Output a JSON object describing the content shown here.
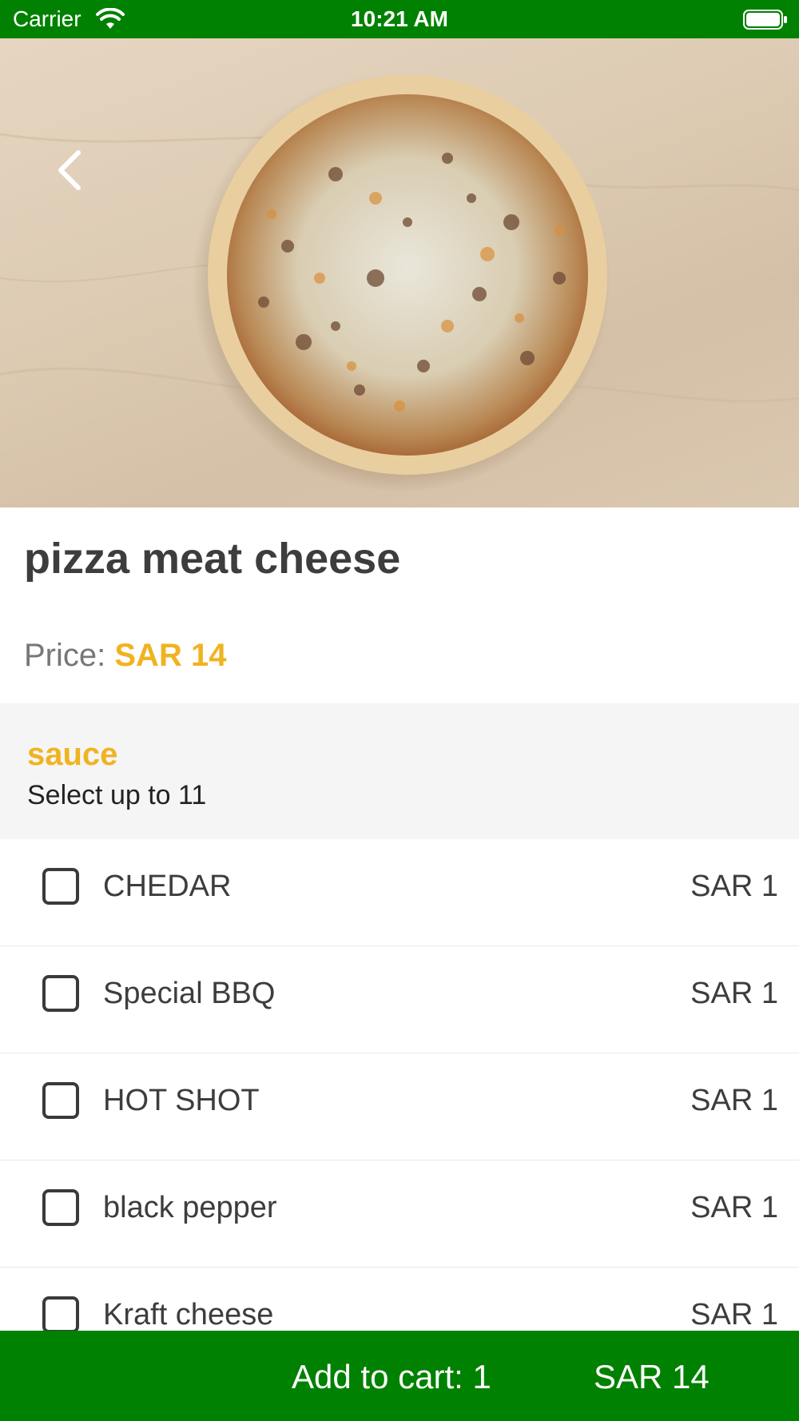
{
  "status_bar": {
    "carrier": "Carrier",
    "time": "10:21 AM",
    "wifi_icon": "wifi-icon",
    "battery_icon": "battery-full-icon"
  },
  "hero": {
    "image": "pizza-photo",
    "back_icon": "chevron-left-icon"
  },
  "product": {
    "title": "pizza meat cheese",
    "price_label": "Price:",
    "price_value": "SAR 14"
  },
  "option_group": {
    "title": "sauce",
    "subtitle": "Select up to 11",
    "options": [
      {
        "label": "CHEDAR",
        "price": "SAR 1",
        "checked": false
      },
      {
        "label": "Special BBQ",
        "price": "SAR 1",
        "checked": false
      },
      {
        "label": "HOT SHOT",
        "price": "SAR 1",
        "checked": false
      },
      {
        "label": "black pepper",
        "price": "SAR 1",
        "checked": false
      },
      {
        "label": "Kraft cheese",
        "price": "SAR 1",
        "checked": false
      }
    ]
  },
  "cart": {
    "label": "Add to cart: 1",
    "total": "SAR 14"
  },
  "colors": {
    "brand_green": "#018101",
    "accent_yellow": "#f0b320"
  }
}
